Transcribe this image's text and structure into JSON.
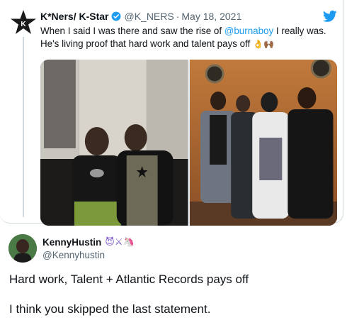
{
  "quoted_tweet": {
    "name": "K*Ners/ K-Star",
    "handle": "@K_NERS",
    "separator": "·",
    "date": "May 18, 2021",
    "text_pre": "When I said I was there and saw the rise of ",
    "mention": "@burnaboy",
    "text_post": " I really was. He's living proof that hard work and talent pays off ",
    "emojis": "👌🙌🏾",
    "verified": true
  },
  "reply": {
    "name": "KennyHustin",
    "name_emojis": "😈⚔🦄",
    "handle": "@Kennyhustin",
    "line1": "Hard work, Talent + Atlantic Records pays off",
    "line2": "I think you skipped the last statement."
  },
  "colors": {
    "accent": "#1d9bf0",
    "border": "#cfd9de",
    "muted": "#536471"
  },
  "icons": {
    "avatar": "star-logo-icon",
    "verified": "verified-badge-icon",
    "brand": "twitter-bird-icon"
  }
}
